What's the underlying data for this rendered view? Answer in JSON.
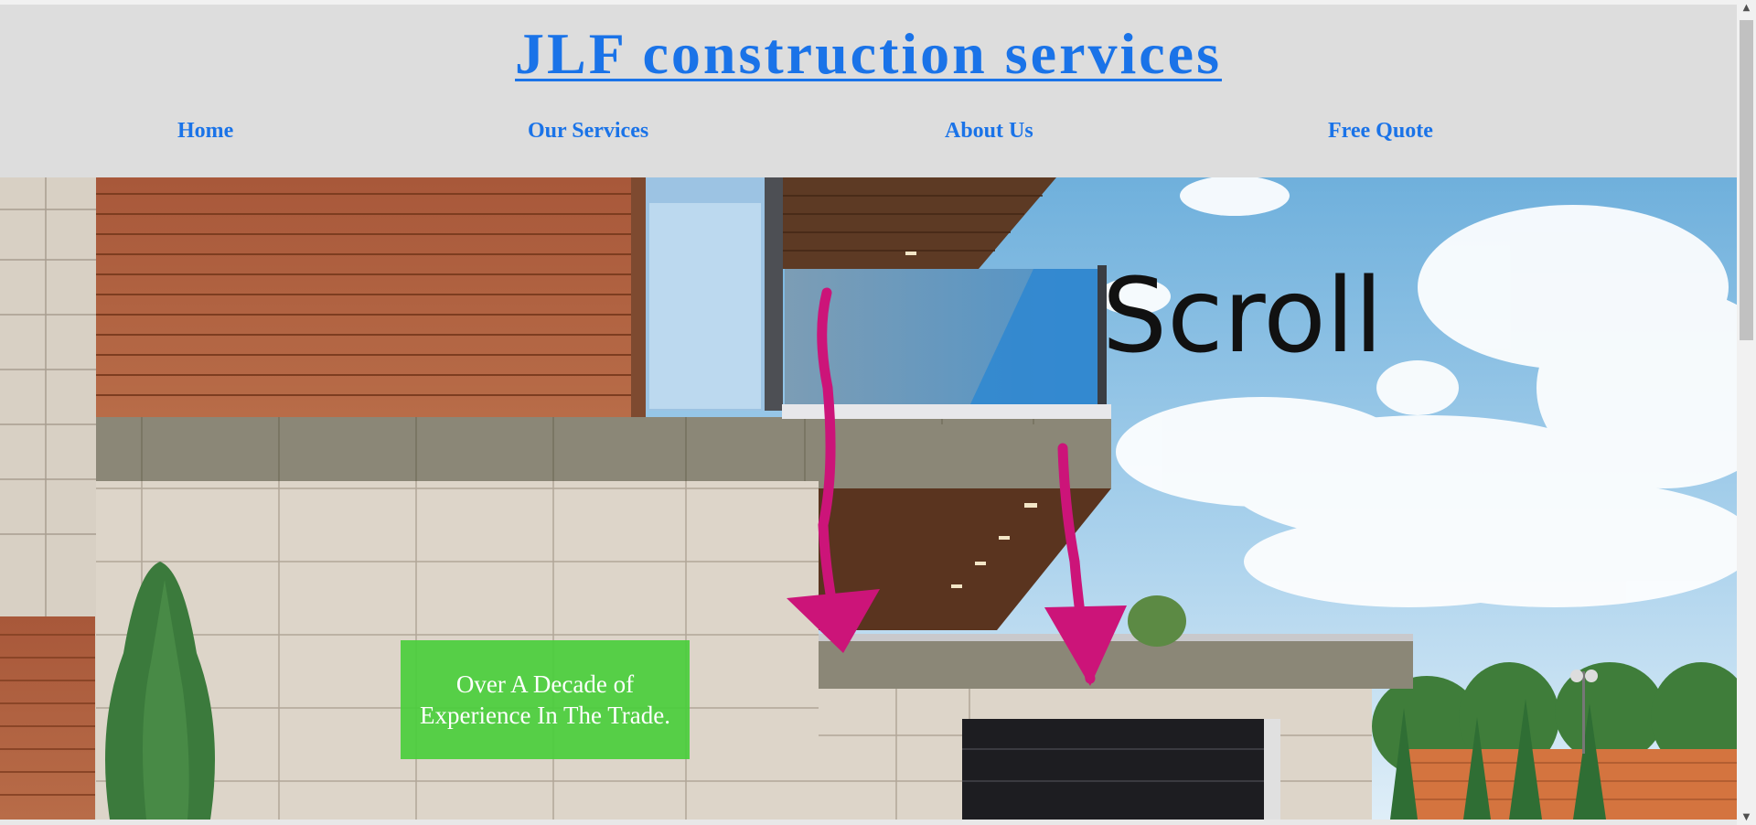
{
  "site": {
    "title": "JLF construction services"
  },
  "nav": {
    "items": [
      {
        "label": "Home"
      },
      {
        "label": "Our Services"
      },
      {
        "label": "About Us"
      },
      {
        "label": "Free Quote"
      }
    ]
  },
  "hero": {
    "badge_line1": "Over A Decade of",
    "badge_line2": "Experience In The Trade.",
    "annotation_text": "Scroll"
  },
  "colors": {
    "header_bg": "#dddddd",
    "link": "#1a73e8",
    "badge_bg": "#4ace3c",
    "annotation_arrow": "#cc1479",
    "annotation_ink": "#111111"
  },
  "icons": {
    "scroll_up": "▲",
    "scroll_down": "▼"
  }
}
